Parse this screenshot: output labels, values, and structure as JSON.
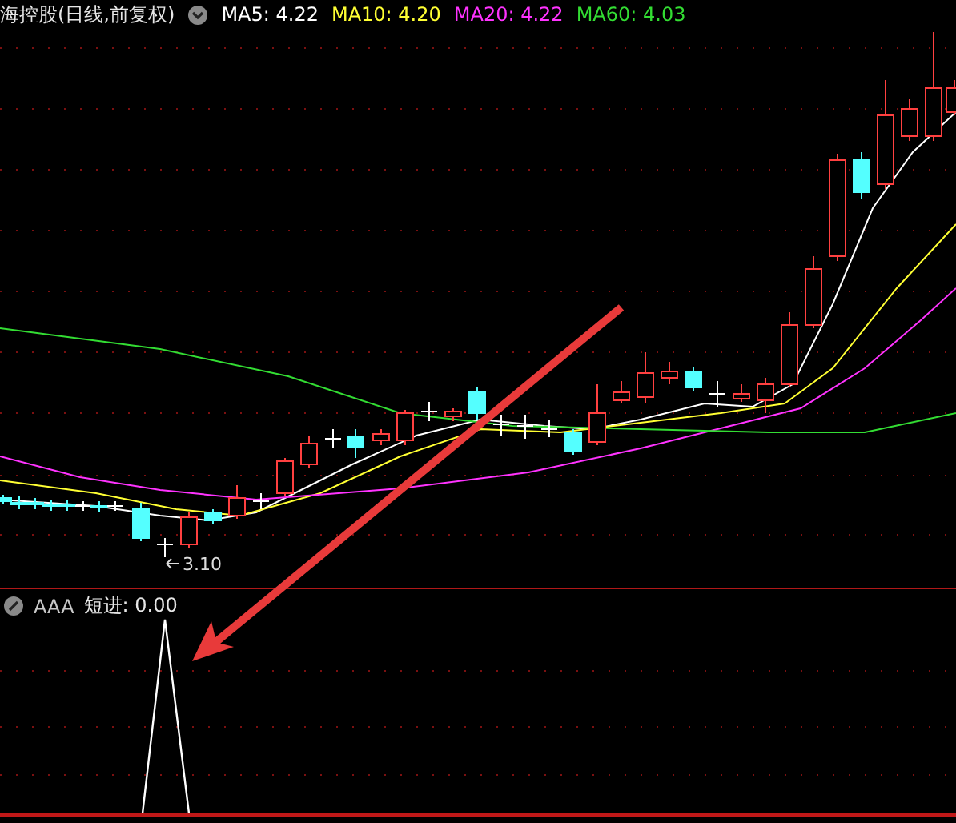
{
  "title": "海控股(日线,前复权)",
  "legend": [
    {
      "label": "MA5: 4.22",
      "color": "#ffffff"
    },
    {
      "label": "MA10: 4.20",
      "color": "#ffff33"
    },
    {
      "label": "MA20: 4.22",
      "color": "#ff33ff"
    },
    {
      "label": "MA60: 4.03",
      "color": "#33dd33"
    }
  ],
  "low_label": "3.10",
  "indicator": {
    "name": "AAA",
    "reading": "短进: 0.00"
  }
}
